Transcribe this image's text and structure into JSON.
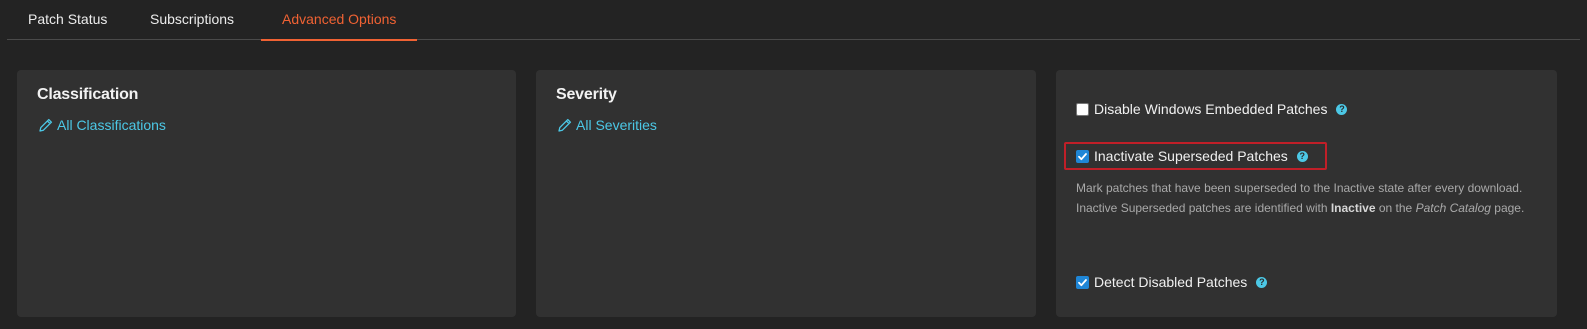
{
  "tabs": [
    {
      "label": "Patch Status",
      "active": false
    },
    {
      "label": "Subscriptions",
      "active": false
    },
    {
      "label": "Advanced Options",
      "active": true
    }
  ],
  "panels": {
    "classification": {
      "title": "Classification",
      "link_label": "All Classifications",
      "link_icon": "pencil-icon"
    },
    "severity": {
      "title": "Severity",
      "link_label": "All Severities",
      "link_icon": "pencil-icon"
    },
    "options": {
      "disable_embedded": {
        "label": "Disable Windows Embedded Patches",
        "checked": false
      },
      "inactivate_superseded": {
        "label": "Inactivate Superseded Patches",
        "checked": true,
        "desc_part1": "Mark patches that have been superseded to the Inactive state after every download. Inactive Superseded patches are identified with ",
        "desc_bold": "Inactive",
        "desc_part2": " on the ",
        "desc_italic": "Patch Catalog",
        "desc_part3": " page."
      },
      "detect_disabled": {
        "label": "Detect Disabled Patches",
        "checked": true
      },
      "help_glyph": "?"
    }
  },
  "colors": {
    "accent": "#f06233",
    "link": "#4cc8e6",
    "checkbox": "#1f86d6",
    "highlight": "#c01f28"
  }
}
